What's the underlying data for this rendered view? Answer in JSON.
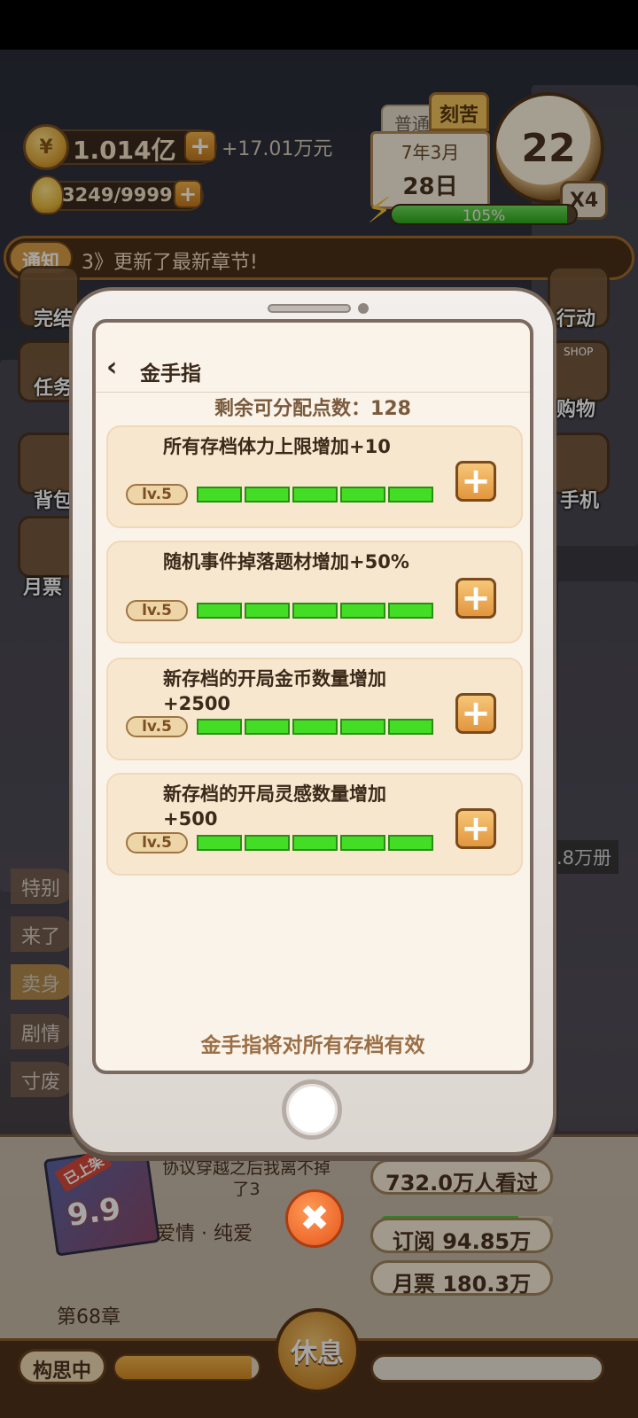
{
  "hud": {
    "coins": "1.014亿",
    "income": "+17.01万元",
    "inspiration": "3249/9999",
    "mode_tab_normal": "普通",
    "mode_tab_hard": "刻苦",
    "date_month": "7年3月",
    "date_day": "28日",
    "clock_value": "22",
    "speed": "X4",
    "energy_text": "105%",
    "energy_level": 0.95
  },
  "notice": {
    "tag": "通知",
    "text": "3》更新了最新章节!"
  },
  "background": {
    "side_labels_left": [
      "完结",
      "任务",
      "背包",
      "月票"
    ],
    "side_labels_right": [
      "行动",
      "购物",
      "手机"
    ],
    "shop_sign": "SHOP",
    "left_tabs": [
      "特别",
      "来了",
      "卖身",
      "剧情",
      "寸废"
    ],
    "readers_badge": ".8万册"
  },
  "modal": {
    "title": "金手指",
    "points_label": "剩余可分配点数：128",
    "footer": "金手指将对所有存档有效",
    "cards": [
      {
        "title": "所有存档体力上限增加+10",
        "level": "lv.5",
        "filled": 5,
        "total": 5
      },
      {
        "title": "随机事件掉落题材增加+50%",
        "level": "lv.5",
        "filled": 5,
        "total": 5
      },
      {
        "title": "新存档的开局金币数量增加+2500",
        "level": "lv.5",
        "filled": 5,
        "total": 5
      },
      {
        "title": "新存档的开局灵感数量增加+500",
        "level": "lv.5",
        "filled": 5,
        "total": 5
      }
    ]
  },
  "book": {
    "cover_tag": "已上架",
    "cover_score": "9.9",
    "title": "协议穿越之后我离不掉了3",
    "genre": "爱情 · 纯爱",
    "chapter": "第68章",
    "views": "732.0万人看过",
    "views_progress": 0.8,
    "subscribe": "订阅 94.85万",
    "monthly_ticket": "月票 180.3万"
  },
  "bottom": {
    "status_label": "构思中",
    "progress": 0.95,
    "rest_label": "休息"
  }
}
